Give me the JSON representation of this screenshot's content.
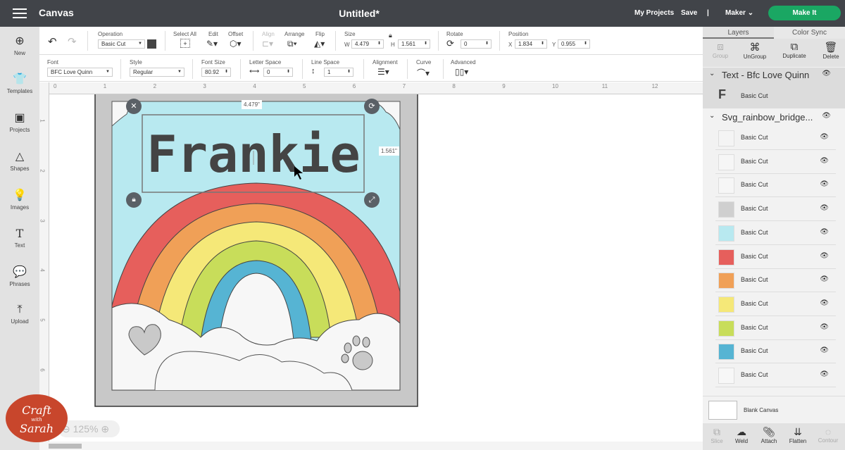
{
  "topbar": {
    "menu_icon": "hamburger-icon",
    "app": "Canvas",
    "title": "Untitled*",
    "my_projects": "My Projects",
    "save": "Save",
    "divider": "|",
    "machine": "Maker",
    "make_it": "Make It"
  },
  "sidebar": {
    "items": [
      {
        "label": "New",
        "icon": "⊕"
      },
      {
        "label": "Templates",
        "icon": "👕"
      },
      {
        "label": "Projects",
        "icon": "▣"
      },
      {
        "label": "Shapes",
        "icon": "△"
      },
      {
        "label": "Images",
        "icon": "💡"
      },
      {
        "label": "Text",
        "icon": "T"
      },
      {
        "label": "Phrases",
        "icon": "💬"
      },
      {
        "label": "Upload",
        "icon": "⤒"
      }
    ]
  },
  "toolbar1": {
    "operation_label": "Operation",
    "operation_value": "Basic Cut",
    "select_all": "Select All",
    "edit": "Edit",
    "offset": "Offset",
    "align": "Align",
    "arrange": "Arrange",
    "flip": "Flip",
    "size": "Size",
    "w_label": "W",
    "w_value": "4.479",
    "h_label": "H",
    "h_value": "1.561",
    "rotate": "Rotate",
    "rotate_value": "0",
    "position": "Position",
    "x_label": "X",
    "x_value": "1.834",
    "y_label": "Y",
    "y_value": "0.955"
  },
  "toolbar2": {
    "font_label": "Font",
    "font_value": "BFC Love Quinn",
    "style_label": "Style",
    "style_value": "Regular",
    "fontsize_label": "Font Size",
    "fontsize_value": "80.92",
    "letter_label": "Letter Space",
    "letter_value": "0",
    "line_label": "Line Space",
    "line_value": "1",
    "alignment": "Alignment",
    "curve": "Curve",
    "advanced": "Advanced"
  },
  "ruler": {
    "h": [
      "0",
      "1",
      "2",
      "3",
      "4",
      "5",
      "6",
      "7",
      "8",
      "9",
      "10",
      "11",
      "12"
    ],
    "v": [
      "1",
      "2",
      "3",
      "4",
      "5",
      "6"
    ]
  },
  "design": {
    "text": "Frankie",
    "width_tag": "4.479\"",
    "height_tag": "1.561\"",
    "colors": {
      "sky": "#b8e9f0",
      "red": "#e65f5c",
      "orange": "#f0a057",
      "yellow": "#f5e878",
      "green": "#c8dd5a",
      "blue": "#56b4d3",
      "frame": "#c8c8c8"
    }
  },
  "zoom": {
    "value": "125%"
  },
  "logo": {
    "line1": "Craft",
    "line2": "with",
    "line3": "Sarah"
  },
  "panel": {
    "tab_layers": "Layers",
    "tab_colorsync": "Color Sync",
    "actions": [
      "Group",
      "UnGroup",
      "Duplicate",
      "Delete"
    ],
    "group1": "Text - Bfc Love Quinn",
    "group1_layers": [
      {
        "name": "Basic Cut",
        "color": "#444444"
      }
    ],
    "group2": "Svg_rainbow_bridge...",
    "group2_layers": [
      {
        "name": "Basic Cut",
        "color": "#f4f4f4"
      },
      {
        "name": "Basic Cut",
        "color": "#f6f6f6"
      },
      {
        "name": "Basic Cut",
        "color": "#f6f6f6"
      },
      {
        "name": "Basic Cut",
        "color": "#cfcfcf"
      },
      {
        "name": "Basic Cut",
        "color": "#b8e9f0"
      },
      {
        "name": "Basic Cut",
        "color": "#e65f5c"
      },
      {
        "name": "Basic Cut",
        "color": "#f0a057"
      },
      {
        "name": "Basic Cut",
        "color": "#f5e878"
      },
      {
        "name": "Basic Cut",
        "color": "#c8dd5a"
      },
      {
        "name": "Basic Cut",
        "color": "#56b4d3"
      },
      {
        "name": "Basic Cut",
        "color": "#f7f7f7"
      }
    ],
    "blank_canvas": "Blank Canvas",
    "bottom_actions": [
      "Slice",
      "Weld",
      "Attach",
      "Flatten",
      "Contour"
    ]
  }
}
